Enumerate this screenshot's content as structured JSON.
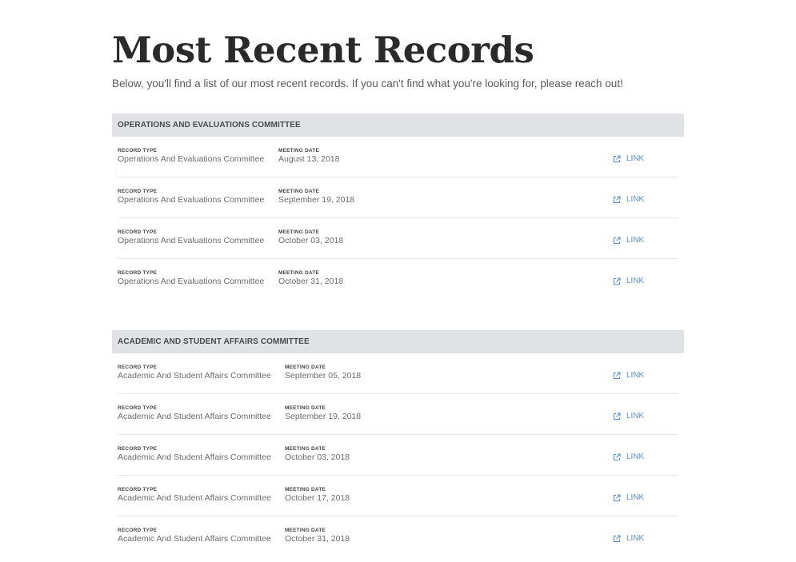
{
  "page": {
    "title": "Most Recent Records",
    "intro": "Below, you'll find a list of our most recent records. If you can't find what you're looking for, please reach out!"
  },
  "labels": {
    "record_type": "RECORD TYPE",
    "meeting_date": "MEETING DATE",
    "link": "LINK"
  },
  "icons": {
    "link": "external-link-icon"
  },
  "colors": {
    "link": "#5a8fce",
    "section_header_bg": "#e1e2e6"
  },
  "sections": [
    {
      "title": "OPERATIONS AND EVALUATIONS COMMITTEE",
      "records": [
        {
          "record_type": "Operations And Evaluations Committee",
          "meeting_date": "August 13, 2018"
        },
        {
          "record_type": "Operations And Evaluations Committee",
          "meeting_date": "September 19, 2018"
        },
        {
          "record_type": "Operations And Evaluations Committee",
          "meeting_date": "October 03, 2018"
        },
        {
          "record_type": "Operations And Evaluations Committee",
          "meeting_date": "October 31, 2018"
        }
      ]
    },
    {
      "title": "ACADEMIC AND STUDENT AFFAIRS COMMITTEE",
      "records": [
        {
          "record_type": "Academic And Student Affairs Committee",
          "meeting_date": "September 05, 2018"
        },
        {
          "record_type": "Academic And Student Affairs Committee",
          "meeting_date": "September 19, 2018"
        },
        {
          "record_type": "Academic And Student Affairs Committee",
          "meeting_date": "October 03, 2018"
        },
        {
          "record_type": "Academic And Student Affairs Committee",
          "meeting_date": "October 17, 2018"
        },
        {
          "record_type": "Academic And Student Affairs Committee",
          "meeting_date": "October 31, 2018"
        }
      ]
    }
  ]
}
